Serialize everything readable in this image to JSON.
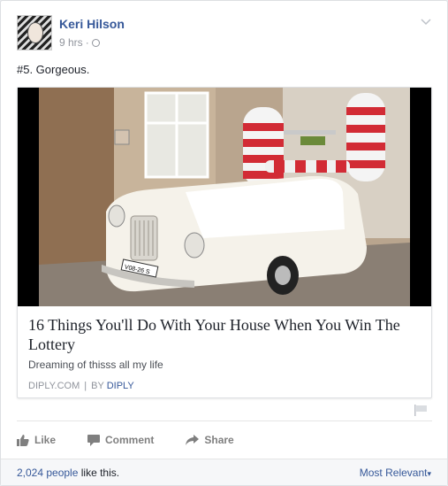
{
  "post": {
    "author": "Keri Hilson",
    "time": "9 hrs",
    "dot": "·",
    "text": "#5. Gorgeous."
  },
  "link": {
    "title": "16 Things You'll Do With Your House When You Win The Lottery",
    "description": "Dreaming of thisss all my life",
    "domain": "DIPLY.COM",
    "separator": "|",
    "by": "BY",
    "author": "DIPLY",
    "plate": "V08-26 S"
  },
  "actions": {
    "like": "Like",
    "comment": "Comment",
    "share": "Share"
  },
  "footer": {
    "likes_count": "2,024 people",
    "likes_suffix": "like this.",
    "sort": "Most Relevant",
    "sort_arrow": "▾"
  },
  "colors": {
    "link_blue": "#365899",
    "muted": "#90949c"
  }
}
